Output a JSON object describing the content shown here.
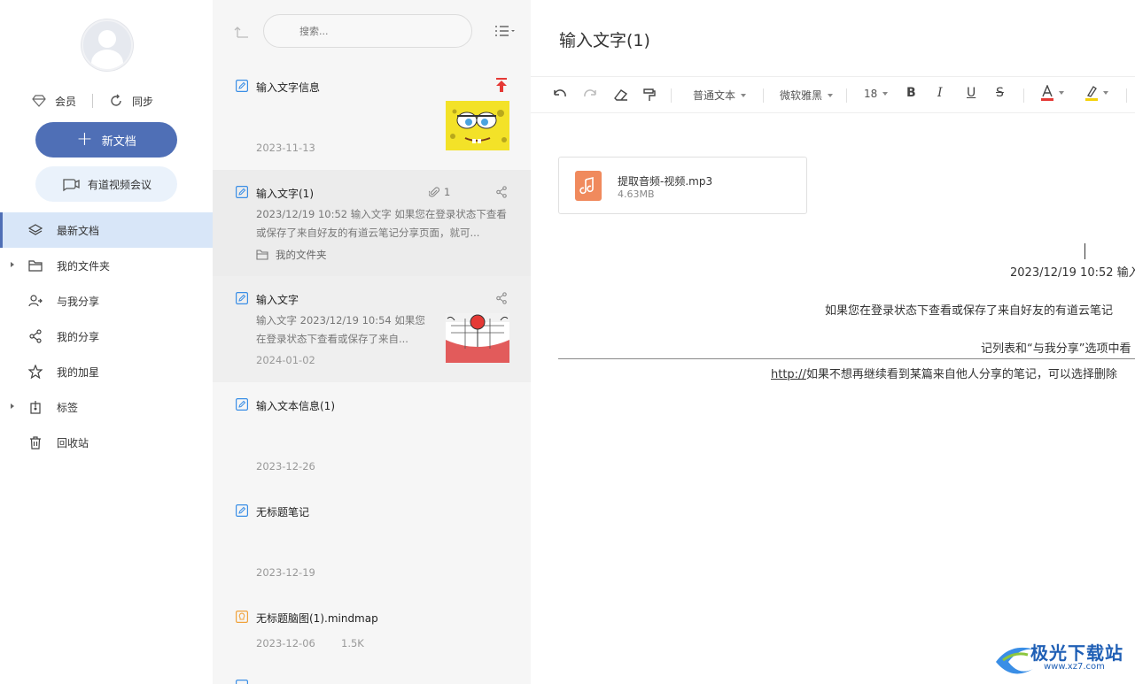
{
  "sidebar": {
    "vip_label": "会员",
    "sync_label": "同步",
    "new_doc_label": "新文档",
    "meeting_label": "有道视频会议",
    "nav": [
      {
        "label": "最新文档",
        "icon": "layers-icon",
        "active": true
      },
      {
        "label": "我的文件夹",
        "icon": "folder-icon",
        "expandable": true
      },
      {
        "label": "与我分享",
        "icon": "users-icon"
      },
      {
        "label": "我的分享",
        "icon": "share-icon"
      },
      {
        "label": "我的加星",
        "icon": "star-icon"
      },
      {
        "label": "标签",
        "icon": "tag-icon",
        "expandable": true
      },
      {
        "label": "回收站",
        "icon": "trash-icon"
      }
    ]
  },
  "list": {
    "search_placeholder": "搜索...",
    "notes": [
      {
        "title": "输入文字信息",
        "date": "2023-11-13",
        "pinned": true,
        "thumb": "spongebob"
      },
      {
        "title": "输入文字(1)",
        "attach_count": "1",
        "snippet": "2023/12/19 10:52 输入文字 如果您在登录状态下查看或保存了来自好友的有道云笔记分享页面，就可...",
        "folder": "我的文件夹",
        "selected": true
      },
      {
        "title": "输入文字",
        "snippet": "输入文字 2023/12/19 10:54 如果您在登录状态下查看或保存了来自...",
        "date": "2024-01-02",
        "thumb": "doraemon"
      },
      {
        "title": "输入文本信息(1)",
        "date": "2023-12-26"
      },
      {
        "title": "无标题笔记",
        "date": "2023-12-19"
      },
      {
        "title": "无标题脑图(1).mindmap",
        "date": "2023-12-06",
        "size": "1.5K"
      }
    ]
  },
  "editor": {
    "title": "输入文字(1)",
    "toolbar": {
      "paragraph_style": "普通文本",
      "font": "微软雅黑",
      "font_size": "18"
    },
    "attachment": {
      "name": "提取音频-视频.mp3",
      "size": "4.63MB"
    },
    "lines": {
      "l1": "2023/12/19 10:52 输入",
      "l2": "如果您在登录状态下查看或保存了来自好友的有道云笔记",
      "l3": "记列表和“与我分享”选项中看",
      "l4_link": "http://",
      "l4_rest": "如果不想再继续看到某篇来自他人分享的笔记，可以选择删除"
    }
  },
  "watermark": {
    "name": "极光下载站",
    "url": "www.xz7.com"
  },
  "colors": {
    "accent": "#4f6fb6",
    "active_nav_bg": "#d8e6f8",
    "pin_red": "#e53935",
    "audio_file": "#f08a5d"
  }
}
